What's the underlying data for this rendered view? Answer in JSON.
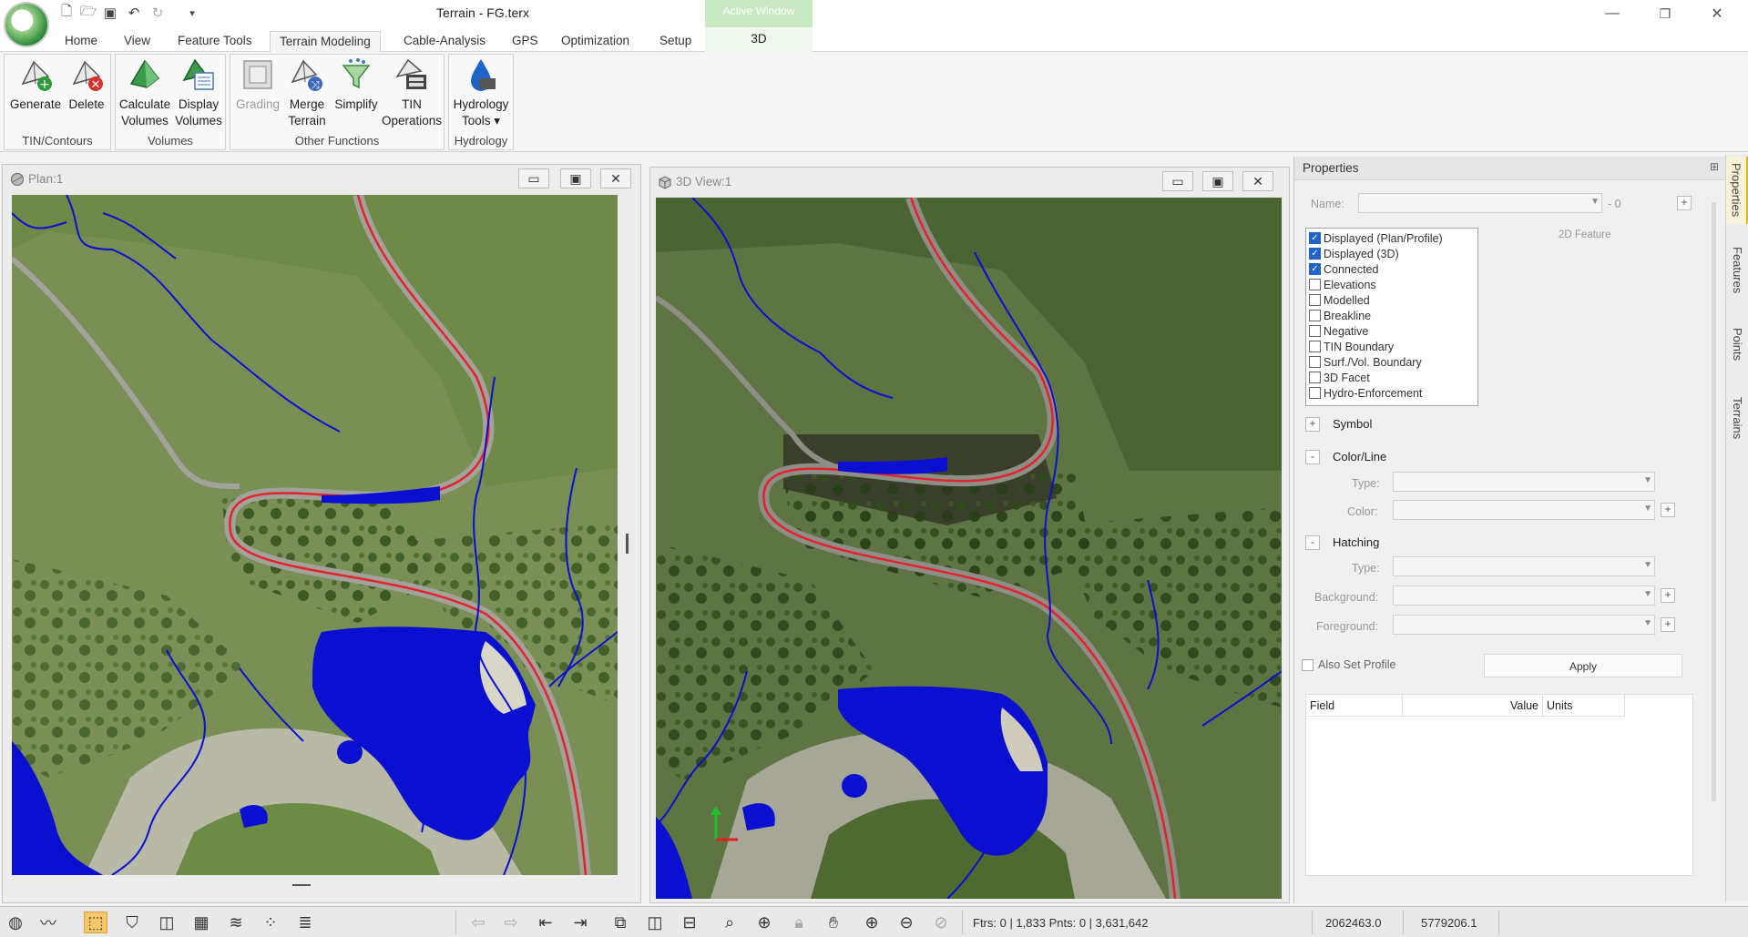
{
  "app": {
    "title": "Terrain - FG.terx",
    "active_window_label": "Active Window"
  },
  "window_controls": {
    "minimize": "—",
    "restore": "❐",
    "close": "✕"
  },
  "qat": [
    "new-icon",
    "open-icon",
    "save-icon",
    "undo-icon",
    "redo-icon"
  ],
  "qat_dropdown": "▾",
  "ribbon": {
    "tabs": [
      "Home",
      "View",
      "Feature Tools",
      "Terrain Modeling",
      "Cable-Analysis",
      "GPS",
      "Optimization",
      "Setup"
    ],
    "active_tab": "Terrain Modeling",
    "contextual_tab": "3D",
    "groups": {
      "tin_contours": {
        "label": "TIN/Contours",
        "generate": "Generate",
        "delete": "Delete"
      },
      "volumes": {
        "label": "Volumes",
        "calc_line1": "Calculate",
        "calc_line2": "Volumes",
        "disp_line1": "Display",
        "disp_line2": "Volumes"
      },
      "other": {
        "label": "Other Functions",
        "grading": "Grading",
        "merge_line1": "Merge",
        "merge_line2": "Terrain",
        "simplify": "Simplify",
        "tin_line1": "TIN",
        "tin_line2": "Operations"
      },
      "hydrology": {
        "label": "Hydrology",
        "tools_line1": "Hydrology",
        "tools_line2": "Tools ▾"
      }
    }
  },
  "plan_view": {
    "title": "Plan:1"
  },
  "view3d": {
    "title": "3D View:1"
  },
  "properties": {
    "header": "Properties",
    "pin": "⊞",
    "name_label": "Name:",
    "name_suffix": "- 0",
    "feature_type": "2D Feature",
    "checks": [
      {
        "label": "Displayed (Plan/Profile)",
        "checked": true
      },
      {
        "label": "Displayed (3D)",
        "checked": true
      },
      {
        "label": "Connected",
        "checked": true
      },
      {
        "label": "Elevations",
        "checked": false
      },
      {
        "label": "Modelled",
        "checked": false
      },
      {
        "label": "Breakline",
        "checked": false
      },
      {
        "label": "Negative",
        "checked": false
      },
      {
        "label": "TIN Boundary",
        "checked": false
      },
      {
        "label": "Surf./Vol. Boundary",
        "checked": false
      },
      {
        "label": "3D Facet",
        "checked": false
      },
      {
        "label": "Hydro-Enforcement",
        "checked": false
      }
    ],
    "symbol": {
      "toggle": "+",
      "label": "Symbol"
    },
    "color_line": {
      "toggle": "-",
      "label": "Color/Line",
      "type_label": "Type:",
      "color_label": "Color:"
    },
    "hatching": {
      "toggle": "-",
      "label": "Hatching",
      "type_label": "Type:",
      "background_label": "Background:",
      "foreground_label": "Foreground:"
    },
    "also_set_profile": "Also Set Profile",
    "apply": "Apply",
    "table_headers": {
      "field": "Field",
      "value": "Value",
      "units": "Units"
    }
  },
  "side_tabs": [
    "Properties",
    "Features",
    "Points",
    "Terrains"
  ],
  "statusbar": {
    "feature_count": "Ftrs: 0 | 1,833  Pnts: 0 | 3,631,642",
    "easting": "2062463.0",
    "northing": "5779206.1"
  },
  "colors": {
    "road_line": "#e3242b",
    "hydrology": "#0a0fd0",
    "terrain_dark": "#3f5a2a",
    "terrain_light": "#8a9a62"
  }
}
